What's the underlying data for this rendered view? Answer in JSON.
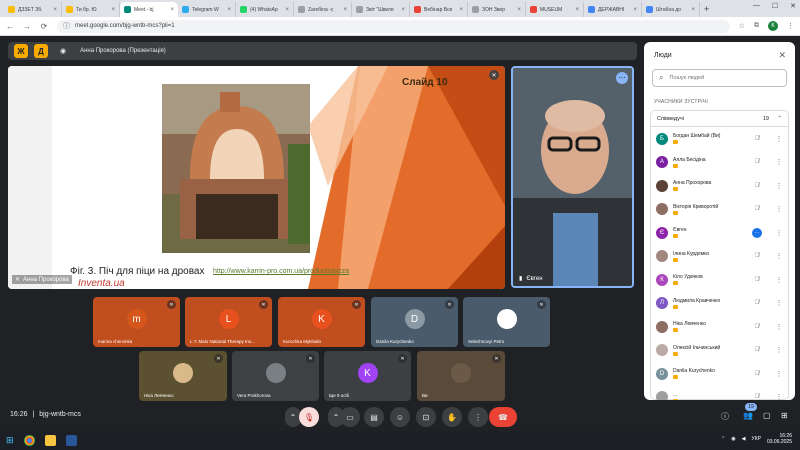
{
  "browser": {
    "tabs": [
      {
        "label": "ДЗЗЕТ Зб.",
        "color": "#fbbc04"
      },
      {
        "label": "Ти бр. Ю",
        "color": "#fbbc04"
      },
      {
        "label": "Meet - bj",
        "color": "#00897b",
        "active": true
      },
      {
        "label": "Telegram W",
        "color": "#2aabee"
      },
      {
        "label": "(4) WhatsAp",
        "color": "#25d366"
      },
      {
        "label": "Zаreбіnа -с",
        "color": "#9aa0a6"
      },
      {
        "label": "Звіт \"Швеле",
        "color": "#9aa0a6"
      },
      {
        "label": "Вебінар Все",
        "color": "#ea4335"
      },
      {
        "label": "ЗОН Звер",
        "color": "#9aa0a6"
      },
      {
        "label": "MUSEUM",
        "color": "#ea4335"
      },
      {
        "label": "ДЕРЖАВНІ",
        "color": "#4285f4"
      },
      {
        "label": "Штабна до",
        "color": "#4285f4"
      }
    ],
    "url": "meet.google.com/bjg-wntb-mcs?pli=1",
    "profile_initial": "К"
  },
  "meet": {
    "yellow_buttons": [
      "Ж",
      "Д"
    ],
    "presenter_title": "Анна Прокорова (Презентація)",
    "slide": {
      "label": "Слайд 10",
      "caption": "Фіг. 3. Піч для піци на дровах",
      "link": "http://www.karrin-pro.com.ua/products/pizza",
      "brand": "Inventa.ua",
      "presenter_name": "Анна Прокорова"
    },
    "speaker_name": "Євген",
    "meeting_time": "16:26",
    "meeting_code": "bjg-wntb-mcs",
    "people_count_badge": "19"
  },
  "tiles": [
    {
      "initial": "m",
      "name": "marina chervinka",
      "bg": "#c04e1f",
      "av": "#d4561a"
    },
    {
      "initial": "L",
      "name": "L.T. Malo National Therapy Ins...",
      "bg": "#c04e1f",
      "av": "#e8501e"
    },
    {
      "initial": "K",
      "name": "Kurochka Mykhailo",
      "bg": "#c04e1f",
      "av": "#e8501e"
    },
    {
      "initial": "D",
      "name": "Danila Kurychenko",
      "bg": "#4a5b6b",
      "av": "#8c9aa6"
    },
    {
      "initial": "",
      "name": "Selezhnovyi Petro",
      "bg": "#4a5b6b",
      "av": "#ffffff"
    },
    {
      "initial": "",
      "name": "Ніка Левченко",
      "bg": "#5b5130",
      "av": "#d9b98a"
    },
    {
      "initial": "",
      "name": "Vera Prokhorova",
      "bg": "#3d4144",
      "av": "#7a7f83"
    },
    {
      "initial": "K",
      "name": "Ще 9 осіб",
      "bg": "#3c4043",
      "av": "#a142f4"
    },
    {
      "initial": "",
      "name": "Ви",
      "bg": "#5a4a3a",
      "av": "#6b5a48"
    }
  ],
  "people_panel": {
    "title": "Люди",
    "search_placeholder": "Пошук людей",
    "section_label": "УЧАСНИКИ ЗУСТРІЧІ",
    "group_label": "Співведучі",
    "group_count": "19",
    "participants": [
      {
        "initial": "Б",
        "name": "Богдан Шембай (Ви)",
        "color": "#00897b",
        "speaking": false
      },
      {
        "initial": "А",
        "name": "Алла Бесідіна",
        "color": "#7b1fa2",
        "speaking": false
      },
      {
        "initial": "",
        "name": "Анна Прохорова",
        "color": "#5d4037",
        "speaking": false
      },
      {
        "initial": "",
        "name": "Вікторія Криворотій",
        "color": "#8d6e63",
        "speaking": false
      },
      {
        "initial": "Є",
        "name": "Євген",
        "color": "#8e24aa",
        "speaking": true
      },
      {
        "initial": "",
        "name": "Ілина Курдемко",
        "color": "#a1887f",
        "speaking": false
      },
      {
        "initial": "К",
        "name": "Кіло Удачков",
        "color": "#ab47bc",
        "speaking": false
      },
      {
        "initial": "Л",
        "name": "Людмила Кравченко",
        "color": "#7e57c2",
        "speaking": false
      },
      {
        "initial": "",
        "name": "Ніка Левченко",
        "color": "#8d6e63",
        "speaking": false
      },
      {
        "initial": "",
        "name": "Олексій Ільчинський",
        "color": "#bcaaa4",
        "speaking": false
      },
      {
        "initial": "D",
        "name": "Danila Kurychenko",
        "color": "#78909c",
        "speaking": false
      },
      {
        "initial": "",
        "name": "...",
        "color": "#9e9e9e",
        "speaking": false
      }
    ]
  },
  "taskbar": {
    "time": "16:26",
    "date": "03.06.2025",
    "lang": "УКР"
  }
}
